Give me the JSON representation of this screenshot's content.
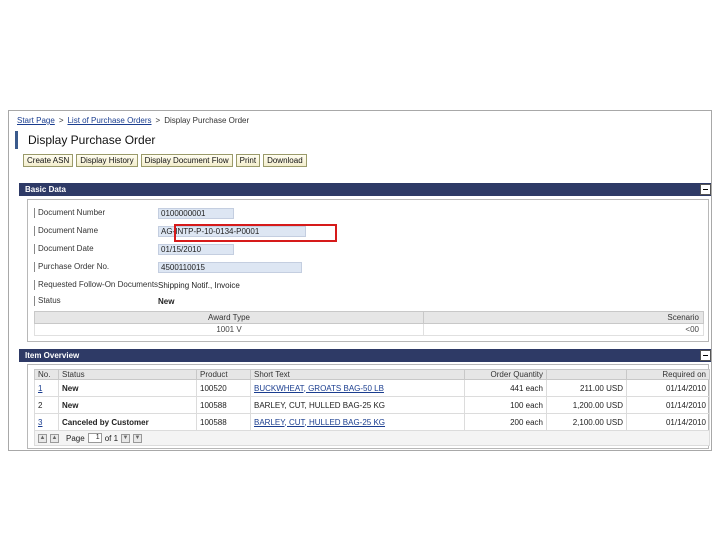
{
  "breadcrumb": {
    "items": [
      "Start Page",
      "List of Purchase Orders"
    ],
    "current": "Display Purchase Order",
    "separator": ">"
  },
  "page_title": "Display Purchase Order",
  "toolbar": {
    "buttons": [
      "Create ASN",
      "Display History",
      "Display Document Flow",
      "Print",
      "Download"
    ]
  },
  "basic_data": {
    "title": "Basic Data",
    "fields": [
      {
        "label": "Document Number",
        "value": "0100000001"
      },
      {
        "label": "Document Name",
        "value": "AG-INTP-P-10-0134-P0001"
      },
      {
        "label": "Document Date",
        "value": "01/15/2010"
      },
      {
        "label": "Purchase Order No.",
        "value": "4500110015"
      },
      {
        "label": "Requested Follow-On Documents",
        "value": "Shipping Notif., Invoice"
      },
      {
        "label": "Status",
        "value": "New"
      }
    ],
    "award_table": {
      "headers": [
        "Award Type",
        "Scenario"
      ],
      "row": [
        "1001 V",
        "<00"
      ]
    }
  },
  "item_overview": {
    "title": "Item Overview",
    "columns": [
      "No.",
      "Status",
      "Product",
      "Short Text",
      "Order Quantity",
      "",
      "Required on"
    ],
    "rows": [
      {
        "no": "1",
        "status": "New",
        "product": "100520",
        "short_text": "BUCKWHEAT, GROATS BAG-50 LB",
        "qty": "441 each",
        "value": "211.00 USD",
        "date": "01/14/2010"
      },
      {
        "no": "2",
        "status": "New",
        "product": "100588",
        "short_text": "BARLEY, CUT, HULLED BAG-25 KG",
        "qty": "100 each",
        "value": "1,200.00 USD",
        "date": "01/14/2010"
      },
      {
        "no": "3",
        "status": "Canceled by Customer",
        "product": "100588",
        "short_text": "BARLEY, CUT, HULLED BAG-25 KG",
        "qty": "200 each",
        "value": "2,100.00 USD",
        "date": "01/14/2010"
      }
    ],
    "pager": {
      "label": "Page",
      "current": "1",
      "of_label": "of 1"
    }
  }
}
